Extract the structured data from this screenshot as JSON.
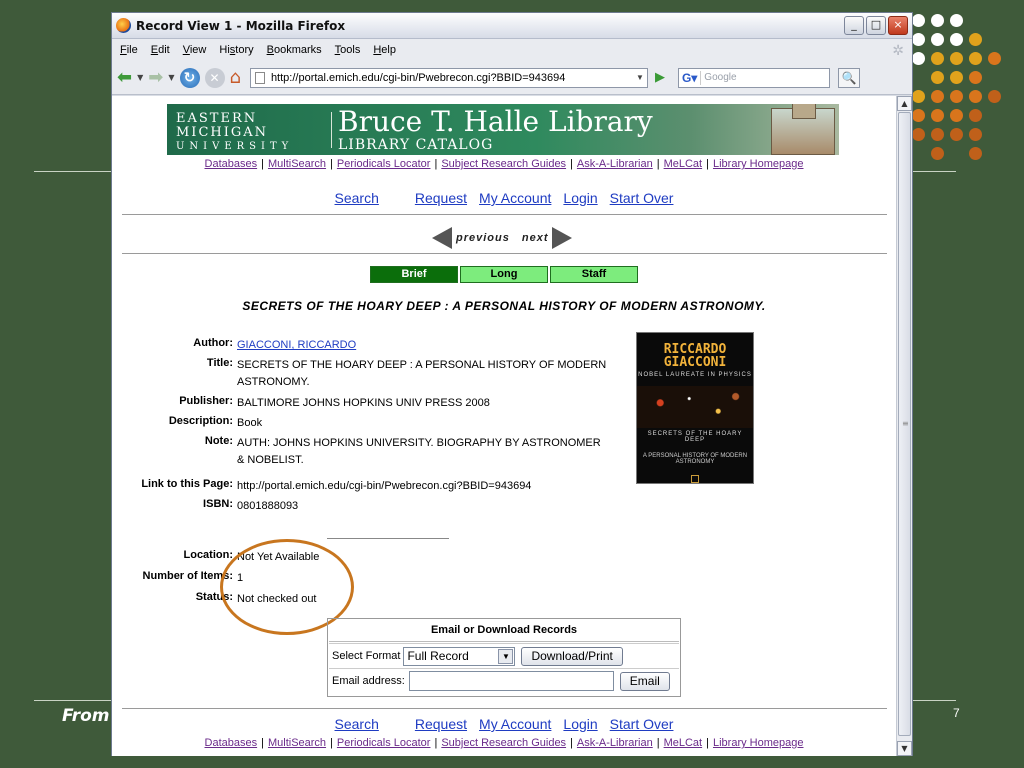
{
  "slide": {
    "footer_text": "From",
    "page_number": "7",
    "dot_colors": [
      "#ffffff",
      "#e0a21c",
      "#d9751c",
      "#c0601a"
    ]
  },
  "window": {
    "title": "Record View 1 - Mozilla Firefox",
    "controls": {
      "minimize": "_",
      "maximize": "□",
      "close": "×"
    }
  },
  "menu": [
    {
      "u": "F",
      "rest": "ile"
    },
    {
      "u": "E",
      "rest": "dit"
    },
    {
      "u": "V",
      "rest": "iew"
    },
    {
      "pre": "Hi",
      "u": "s",
      "rest": "tory"
    },
    {
      "u": "B",
      "rest": "ookmarks"
    },
    {
      "u": "T",
      "rest": "ools"
    },
    {
      "u": "H",
      "rest": "elp"
    }
  ],
  "toolbar": {
    "url": "http://portal.emich.edu/cgi-bin/Pwebrecon.cgi?BBID=943694",
    "search_placeholder": "Google"
  },
  "banner": {
    "org_line1": "EASTERN MICHIGAN",
    "org_line2": "UNIVERSITY",
    "library_name": "Bruce T. Halle Library",
    "catalog_name": "LIBRARY CATALOG"
  },
  "top_links": [
    "Databases",
    "MultiSearch",
    "Periodicals Locator",
    "Subject Research Guides",
    "Ask-A-Librarian",
    "MeLCat",
    "Library Homepage"
  ],
  "nav_links": [
    "Search",
    "Request",
    "My Account",
    "Login",
    "Start Over"
  ],
  "prev_next": {
    "previous": "previous",
    "next": "next"
  },
  "tabs": [
    {
      "label": "Brief",
      "active": true
    },
    {
      "label": "Long",
      "active": false
    },
    {
      "label": "Staff",
      "active": false
    }
  ],
  "record": {
    "heading": "SECRETS OF THE HOARY DEEP : A PERSONAL HISTORY OF MODERN ASTRONOMY.",
    "author_label": "Author:",
    "author": "GIACCONI, RICCARDO",
    "title_label": "Title:",
    "title": "SECRETS OF THE HOARY DEEP : A PERSONAL HISTORY OF MODERN ASTRONOMY.",
    "publisher_label": "Publisher:",
    "publisher": "BALTIMORE JOHNS HOPKINS UNIV PRESS 2008",
    "description_label": "Description:",
    "description": "Book",
    "note_label": "Note:",
    "note": "AUTH: JOHNS HOPKINS UNIVERSITY. BIOGRAPHY BY ASTRONOMER & NOBELIST.",
    "link_label": "Link to this Page:",
    "link": "http://portal.emich.edu/cgi-bin/Pwebrecon.cgi?BBID=943694",
    "isbn_label": "ISBN:",
    "isbn": "0801888093",
    "location_label": "Location:",
    "location": "Not Yet Available",
    "items_label": "Number of Items:",
    "items": "1",
    "status_label": "Status:",
    "status": "Not checked out"
  },
  "cover": {
    "title": "RICCARDO GIACCONI",
    "subtitle": "NOBEL LAUREATE IN PHYSICS",
    "book_title": "SECRETS OF THE HOARY DEEP",
    "book_sub": "A PERSONAL HISTORY OF MODERN ASTRONOMY"
  },
  "email_box": {
    "heading": "Email or Download Records",
    "format_label": "Select Format",
    "format_value": "Full Record",
    "download_button": "Download/Print",
    "email_label": "Email address:",
    "email_value": "",
    "email_button": "Email"
  }
}
